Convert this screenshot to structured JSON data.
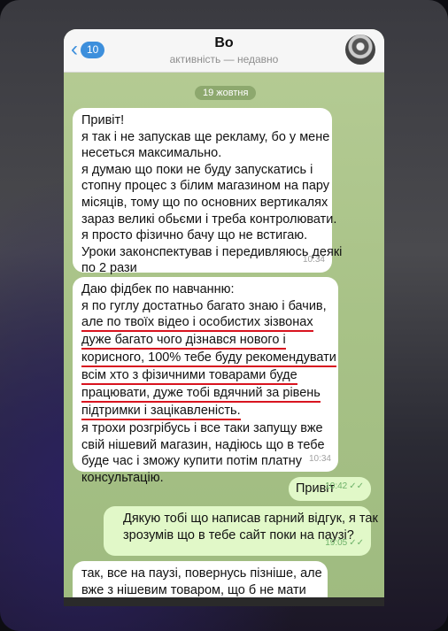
{
  "header": {
    "back_count": "10",
    "title": "Во",
    "subtitle": "активність — недавно"
  },
  "date_divider": "19 жовтня",
  "messages": [
    {
      "direction": "incoming",
      "lines": [
        "Привіт!",
        "я так і не запускав ще рекламу, бо у мене",
        "несеться максимально.",
        "я думаю що поки не буду запускатись і",
        "стопну процес з білим магазином на пару",
        "місяців, тому що по основних вертикалях",
        "зараз великі обьєми і треба контролювати.",
        "я просто фізично бачу що не встигаю.",
        "Уроки законспектував і передивляюсь деякі",
        "по 2 рази"
      ],
      "time": "10:34"
    },
    {
      "direction": "incoming",
      "lines": [
        "Даю фідбек по навчанню:",
        "я по гуглу достатньо багато знаю і бачив,",
        "але по твоїх відео і особистих зізвонах",
        "дуже багато чого дізнався нового і",
        "корисного, 100% тебе буду рекомендувати",
        "всім хто з фізичними товарами буде",
        "працювати, дуже тобі вдячний за рівень",
        "підтримки і зацікавленість.",
        "я трохи розгрібусь і все таки запущу вже",
        "свій нішевий магазин, надіюсь що в тебе",
        "буде час і зможу купити потім платну",
        "консультацію."
      ],
      "time": "10:34"
    },
    {
      "direction": "outgoing",
      "lines": [
        "Привіт"
      ],
      "time": "10:42"
    },
    {
      "direction": "outgoing",
      "lines": [
        "Дякую тобі що написав гарний відгук, я так",
        "зрозумів що в тебе сайт поки на паузі?"
      ],
      "time": "19:05"
    },
    {
      "direction": "incoming",
      "lines": [
        "так, все на паузі, повернусь пізніше, але",
        "вже з нішевим товаром, що б не мати"
      ],
      "time": ""
    }
  ],
  "colors": {
    "accent": "#3d8fdc",
    "underline": "#d8141f",
    "incoming_bubble": "#ffffff",
    "outgoing_bubble": "#e1f8c8"
  }
}
